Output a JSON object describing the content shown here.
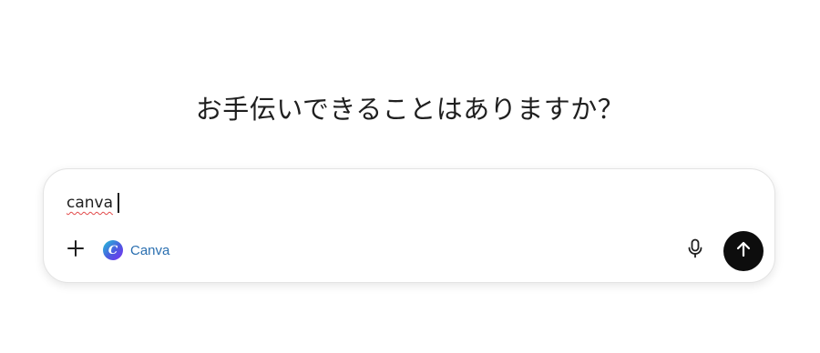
{
  "main": {
    "heading": "お手伝いできることはありますか？"
  },
  "composer": {
    "input_value": "canva",
    "tool_chip": {
      "label": "Canva",
      "logo_letter": "C",
      "icon": "canva-logo-icon"
    },
    "icons": {
      "add": "plus-icon",
      "voice": "microphone-icon",
      "send": "arrow-up-icon"
    },
    "colors": {
      "send_button": "#0d0d0d",
      "tool_label": "#2a6fb0",
      "spellcheck_underline": "#e24a4a"
    }
  }
}
